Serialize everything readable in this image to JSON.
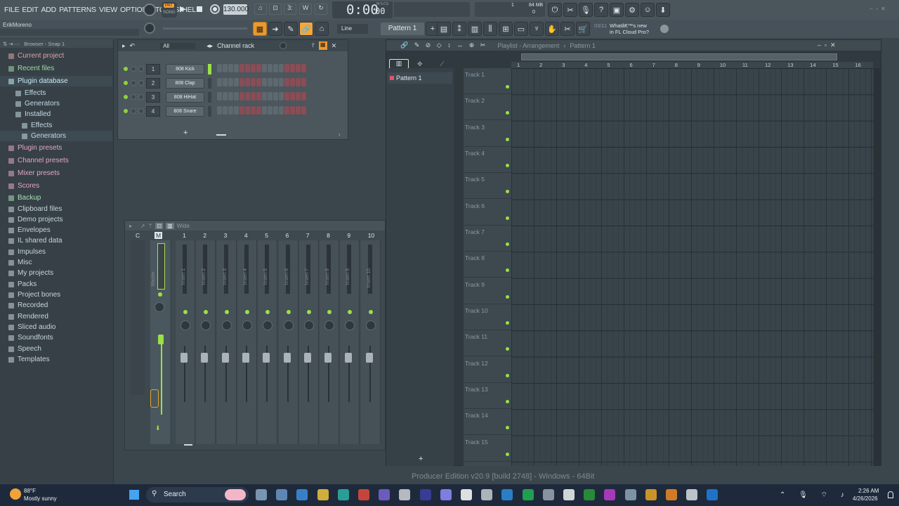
{
  "menu": [
    "FILE",
    "EDIT",
    "ADD",
    "PATTERNS",
    "VIEW",
    "OPTIONS",
    "TOOLS",
    "HELP"
  ],
  "tempo": "130.000",
  "time": "0:00",
  "time_sub": "00",
  "time_unit": "M:S:CS",
  "pat_label": "PAT",
  "song_label": "SONG",
  "memory": "84 MB",
  "cpu_top": "1",
  "cpu_bottom": "0",
  "news_date": "03/11",
  "news_text": "Whatâ€™s new in FL Cloud Pro?",
  "user": "ErikMoreno",
  "snap_mode": "Line",
  "pattern_select": "Pattern 1",
  "browser": {
    "title": "Browser - Snap 1",
    "items": [
      {
        "label": "Current project",
        "color": "#e0a0a8"
      },
      {
        "label": "Recent files",
        "color": "#9fd9a8"
      },
      {
        "label": "Plugin database",
        "color": "#c7ebf5"
      },
      {
        "label": "Effects",
        "color": "#c4dbe6"
      },
      {
        "label": "Generators",
        "color": "#c4dbe6"
      },
      {
        "label": "Installed",
        "color": "#c4dbe6"
      },
      {
        "label": "Effects",
        "color": "#c4dbe6"
      },
      {
        "label": "Generators",
        "color": "#c4dbe6"
      },
      {
        "label": "Plugin presets",
        "color": "#e4a6c6"
      },
      {
        "label": "Channel presets",
        "color": "#e4a6c6"
      },
      {
        "label": "Mixer presets",
        "color": "#e4a6c6"
      },
      {
        "label": "Scores",
        "color": "#e4a6c6"
      },
      {
        "label": "Backup",
        "color": "#a7e0b2"
      },
      {
        "label": "Clipboard files",
        "color": "#c6d6dc"
      },
      {
        "label": "Demo projects",
        "color": "#c6d6dc"
      },
      {
        "label": "Envelopes",
        "color": "#c6d6dc"
      },
      {
        "label": "IL shared data",
        "color": "#c6d6dc"
      },
      {
        "label": "Impulses",
        "color": "#c6d6dc"
      },
      {
        "label": "Misc",
        "color": "#c6d6dc"
      },
      {
        "label": "My projects",
        "color": "#c6d6dc"
      },
      {
        "label": "Packs",
        "color": "#c6d6dc"
      },
      {
        "label": "Project bones",
        "color": "#c6d6dc"
      },
      {
        "label": "Recorded",
        "color": "#c6d6dc"
      },
      {
        "label": "Rendered",
        "color": "#c6d6dc"
      },
      {
        "label": "Sliced audio",
        "color": "#c6d6dc"
      },
      {
        "label": "Soundfonts",
        "color": "#c6d6dc"
      },
      {
        "label": "Speech",
        "color": "#c6d6dc"
      },
      {
        "label": "Templates",
        "color": "#c6d6dc"
      }
    ]
  },
  "channel_rack": {
    "title": "Channel rack",
    "filter": "All",
    "channels": [
      {
        "num": "1",
        "name": "808 Kick"
      },
      {
        "num": "2",
        "name": "808 Clap"
      },
      {
        "num": "3",
        "name": "808 HiHat"
      },
      {
        "num": "4",
        "name": "808 Snare"
      }
    ]
  },
  "mixer": {
    "mode": "Wide",
    "master": "Master",
    "c_label": "C",
    "m_label": "M",
    "inserts": [
      "Insert 1",
      "Insert 2",
      "Insert 3",
      "Insert 4",
      "Insert 5",
      "Insert 6",
      "Insert 7",
      "Insert 8",
      "Insert 9",
      "Insert 10"
    ],
    "numbers": [
      "1",
      "2",
      "3",
      "4",
      "5",
      "6",
      "7",
      "8",
      "9",
      "10"
    ]
  },
  "playlist": {
    "title": "Playlist - Arrangement",
    "pattern_title": "Pattern 1",
    "pattern_item": "Pattern 1",
    "tracks": [
      "Track 1",
      "Track 2",
      "Track 3",
      "Track 4",
      "Track 5",
      "Track 6",
      "Track 7",
      "Track 8",
      "Track 9",
      "Track 10",
      "Track 11",
      "Track 12",
      "Track 13",
      "Track 14",
      "Track 15"
    ],
    "bars": [
      "1",
      "2",
      "3",
      "4",
      "5",
      "6",
      "7",
      "8",
      "9",
      "10",
      "11",
      "12",
      "13",
      "14",
      "15",
      "16"
    ]
  },
  "status_text": "Producer Edition v20.9 [build 2748] - Windows - 64Bit",
  "taskbar": {
    "weather_temp": "88°F",
    "weather_desc": "Mostly sunny",
    "search": "Search",
    "clock_time": "2:26 AM",
    "clock_date": "4/26/2026"
  }
}
